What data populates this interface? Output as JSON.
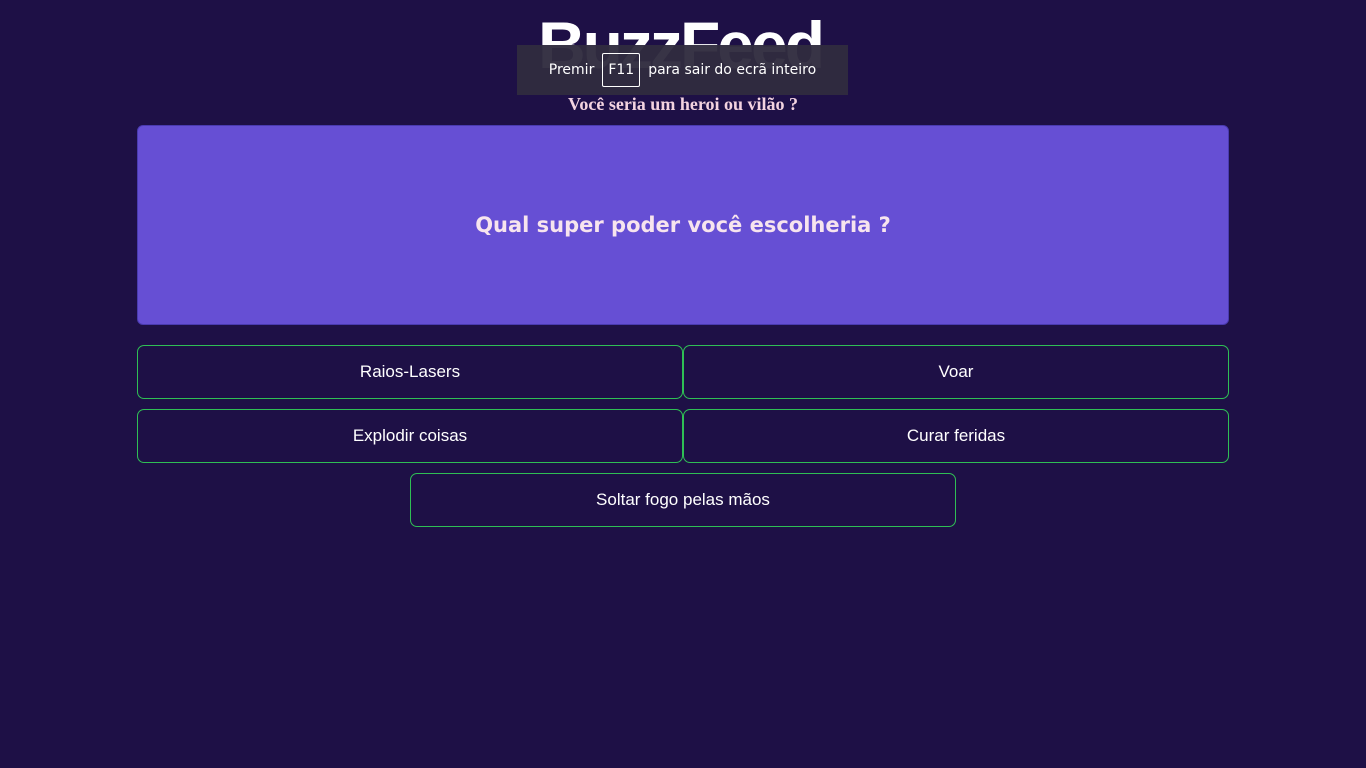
{
  "header": {
    "logo_text": "BuzzFeed",
    "subtitle": "Você seria um heroi ou vilão ?"
  },
  "fullscreen_notice": {
    "prefix": "Premir",
    "key": "F11",
    "suffix": "para sair do ecrã inteiro"
  },
  "quiz": {
    "question": "Qual super poder você escolheria ?",
    "answers": [
      "Raios-Lasers",
      "Voar",
      "Explodir coisas",
      "Curar feridas",
      "Soltar fogo pelas mãos"
    ]
  },
  "colors": {
    "background": "#1e1046",
    "card": "#664fd4",
    "answer_border": "#2fbf55",
    "subtitle": "#f3d3e0"
  }
}
